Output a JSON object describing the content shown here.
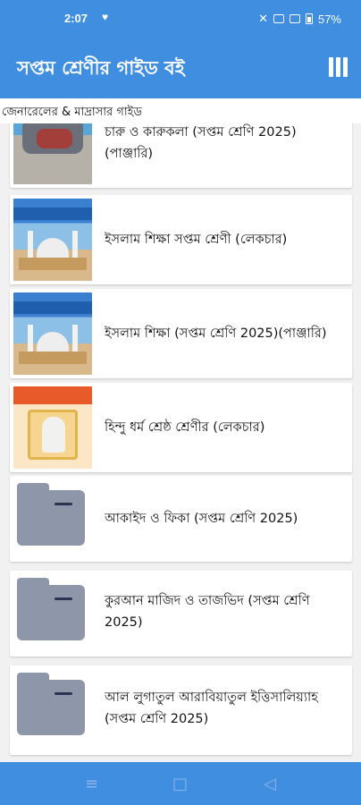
{
  "status_bar": {
    "time": "2:07",
    "heart_icon": "heart-icon",
    "battery": "57%"
  },
  "app_bar": {
    "title": "সপ্তম শ্রেণীর গাইড বই",
    "menu_icon": "menu-icon"
  },
  "subtitle": "জেনারেলের & মাদ্রাসার গাইড",
  "items": [
    {
      "title": "চারু ও কারুকলা  (সপ্তম শ্রেণি 2025)(পাঞ্জারি)",
      "thumb": "crafts-cover"
    },
    {
      "title": "ইসলাম শিক্ষা সপ্তম শ্রেণী (লেকচার)",
      "thumb": "islam-cover"
    },
    {
      "title": "ইসলাম শিক্ষা  (সপ্তম শ্রেণি 2025)(পাঞ্জারি)",
      "thumb": "islam-cover"
    },
    {
      "title": "হিন্দু ধর্ম শ্রেষ্ঠ শ্রেণীর (লেকচার)",
      "thumb": "hindu-cover"
    },
    {
      "title": "আকাইদ ও ফিকা  (সপ্তম শ্রেণি 2025)",
      "thumb": "folder-icon"
    },
    {
      "title": "কুরআন মাজিদ ও তাজভিদ  (সপ্তম শ্রেণি 2025)",
      "thumb": "folder-icon"
    },
    {
      "title": "আল লুগাতুল আরাবিয়াতুল ইত্তিসালিয়্যাহ (সপ্তম শ্রেণি 2025)",
      "thumb": "folder-icon"
    }
  ],
  "nav_bar": {
    "menu_icon": "≡",
    "home_icon": "□",
    "back_icon": "◁"
  },
  "colors": {
    "primary": "#3f8ee0",
    "folder": "#8e96aa"
  }
}
